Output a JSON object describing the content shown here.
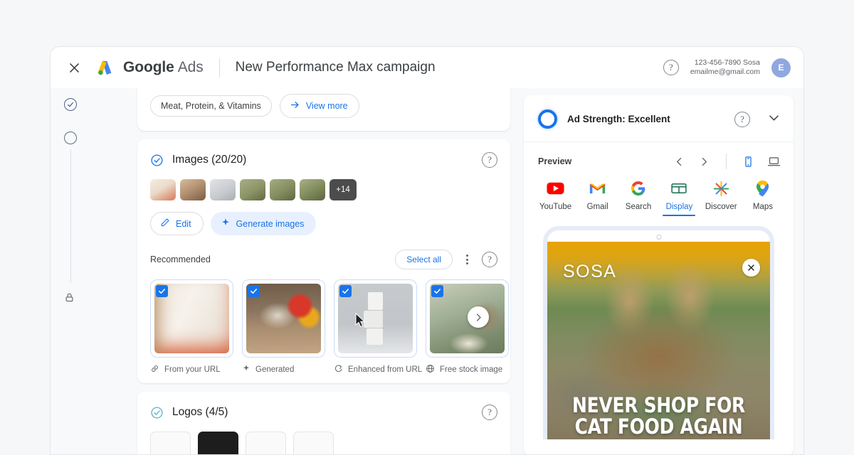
{
  "topbar": {
    "close_icon": "close-icon",
    "brand_name": "Google",
    "brand_suffix": "Ads",
    "campaign_title": "New Performance Max campaign",
    "help_glyph": "?",
    "account_id": "123-456-7890 Sosa",
    "account_email": "emailme@gmail.com",
    "avatar_initial": "E"
  },
  "rail": {
    "step_done_icon": "check-circle-icon",
    "step_current_icon": "circle-icon",
    "step_locked_icon": "lock-icon"
  },
  "top_card": {
    "chip_label": "Meat, Protein, & Vitamins",
    "view_more_label": "View more",
    "view_more_icon": "arrow-right-icon"
  },
  "images_section": {
    "status_icon": "check-circle-icon",
    "title": "Images (20/20)",
    "help_glyph": "?",
    "overflow_count": "+14",
    "thumbnails": [
      {
        "name": "thumb-cat-tree",
        "color1": "#f3e3d8",
        "color2": "#d9a58c"
      },
      {
        "name": "thumb-cat-basket",
        "color1": "#c9a98c",
        "color2": "#8a6a52"
      },
      {
        "name": "thumb-cans-stack",
        "color1": "#d7d9dc",
        "color2": "#aeb2b8"
      },
      {
        "name": "thumb-cat-bowl-1",
        "color1": "#9aa37c",
        "color2": "#6e7a52"
      },
      {
        "name": "thumb-cat-bowl-2",
        "color1": "#9aa37c",
        "color2": "#76804f"
      },
      {
        "name": "thumb-cat-bowl-3",
        "color1": "#a3a87e",
        "color2": "#707a4d"
      }
    ],
    "edit_label": "Edit",
    "edit_icon": "pencil-icon",
    "generate_label": "Generate images",
    "generate_icon": "sparkle-icon",
    "recommended_label": "Recommended",
    "select_all_label": "Select all",
    "kebab_icon": "more-vert-icon",
    "next_icon": "chevron-right-icon",
    "cards": [
      {
        "caption": "From your URL",
        "icon": "link-icon",
        "checked": true,
        "c1": "#f2efe9",
        "c2": "#c9a57e",
        "c3": "#e2573a"
      },
      {
        "caption": "Generated",
        "icon": "sparkle-icon",
        "checked": true,
        "c1": "#8b7a67",
        "c2": "#d8cdbd",
        "c3": "#d23a2c"
      },
      {
        "caption": "Enhanced from URL",
        "icon": "enhance-icon",
        "checked": true,
        "c1": "#c3c6ca",
        "c2": "#eceef0",
        "c3": "#9aa0a6"
      },
      {
        "caption": "Free stock image",
        "icon": "globe-icon",
        "checked": true,
        "c1": "#b9c2a8",
        "c2": "#7f8a6c",
        "c3": "#d8d2c4"
      }
    ]
  },
  "logos_section": {
    "status_icon": "check-circle-icon",
    "title": "Logos (4/5)",
    "help_glyph": "?",
    "logos": [
      {
        "name": "logo-thumb-1",
        "dark": false
      },
      {
        "name": "logo-thumb-2",
        "dark": true
      },
      {
        "name": "logo-thumb-3",
        "dark": false
      },
      {
        "name": "logo-thumb-4",
        "dark": false
      }
    ]
  },
  "preview_panel": {
    "ad_strength_label": "Ad Strength: Excellent",
    "ring_color": "#1a73e8",
    "help_glyph": "?",
    "collapse_icon": "chevron-down-icon",
    "preview_label": "Preview",
    "prev_icon": "chevron-left-icon",
    "next_icon": "chevron-right-icon",
    "mobile_icon": "smartphone-icon",
    "desktop_icon": "laptop-icon",
    "active_device": "mobile",
    "tabs": [
      {
        "label": "YouTube",
        "icon": "youtube-icon",
        "active": false
      },
      {
        "label": "Gmail",
        "icon": "gmail-icon",
        "active": false
      },
      {
        "label": "Search",
        "icon": "google-g-icon",
        "active": false
      },
      {
        "label": "Display",
        "icon": "display-icon",
        "active": true
      },
      {
        "label": "Discover",
        "icon": "discover-icon",
        "active": false
      },
      {
        "label": "Maps",
        "icon": "maps-pin-icon",
        "active": false
      }
    ],
    "ad": {
      "brand_text": "SOSA",
      "close_icon": "close-icon",
      "headline_line1": "NEVER SHOP FOR",
      "headline_line2": "CAT FOOD AGAIN"
    }
  }
}
